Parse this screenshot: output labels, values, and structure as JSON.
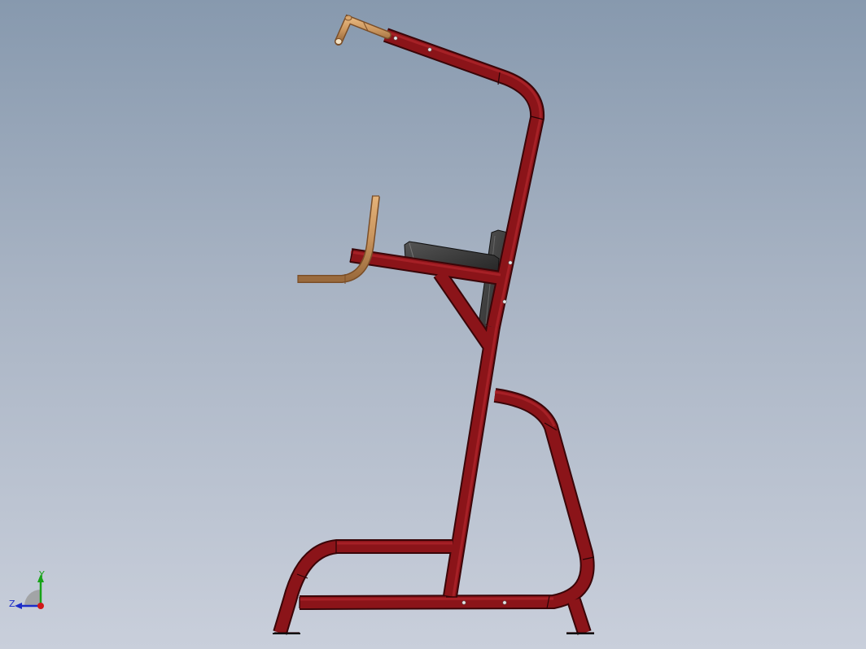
{
  "viewport": {
    "background_top": "#8799ae",
    "background_bottom": "#c9cfdb"
  },
  "model": {
    "frame_color": "#8b1419",
    "frame_edge_color": "#3a0508",
    "handle_color": "#c9955e",
    "pad_color": "#2e2e2e"
  },
  "triad": {
    "y_label": "Y",
    "z_label": "Z",
    "y_color": "#17a317",
    "z_color": "#1c2cc8",
    "x_color": "#d01818"
  }
}
